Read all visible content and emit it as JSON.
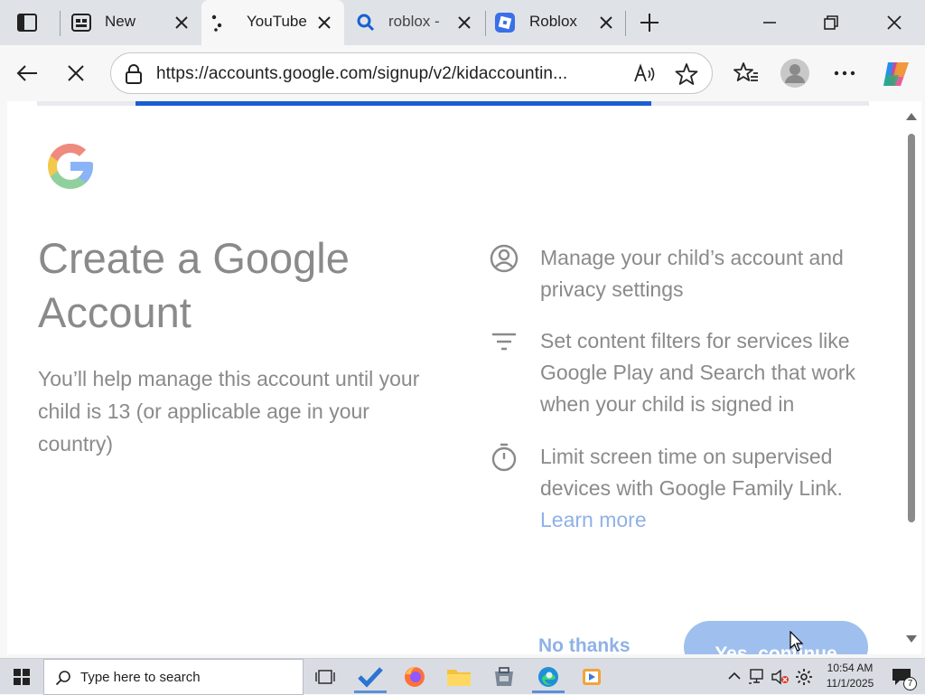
{
  "browser": {
    "tabs": [
      {
        "title": "New tab",
        "active": false
      },
      {
        "title": "YouTube",
        "active": true
      },
      {
        "title": "roblox -",
        "active": false
      },
      {
        "title": "Roblox",
        "active": false
      }
    ],
    "url": "https://accounts.google.com/signup/v2/kidaccountin..."
  },
  "page": {
    "title": "Create a Google Account",
    "subtitle": "You’ll help manage this account until your child is 13 (or applicable age in your country)",
    "features": [
      {
        "icon": "account-circle-icon",
        "text": "Manage your child’s account and privacy settings"
      },
      {
        "icon": "filter-icon",
        "text": "Set content filters for services like Google Play and Search that work when your child is signed in"
      },
      {
        "icon": "timer-icon",
        "text": "Limit screen time on supervised devices with Google Family Link."
      }
    ],
    "learn_more": "Learn more",
    "no_thanks": "No thanks",
    "yes_continue": "Yes, continue"
  },
  "taskbar": {
    "search_placeholder": "Type here to search",
    "time": "10:54 AM",
    "date": "11/1/2025",
    "notification_count": "7"
  },
  "colors": {
    "accent": "#1a5fd1",
    "link": "#8fb1e6",
    "button": "#9fc0ee"
  }
}
